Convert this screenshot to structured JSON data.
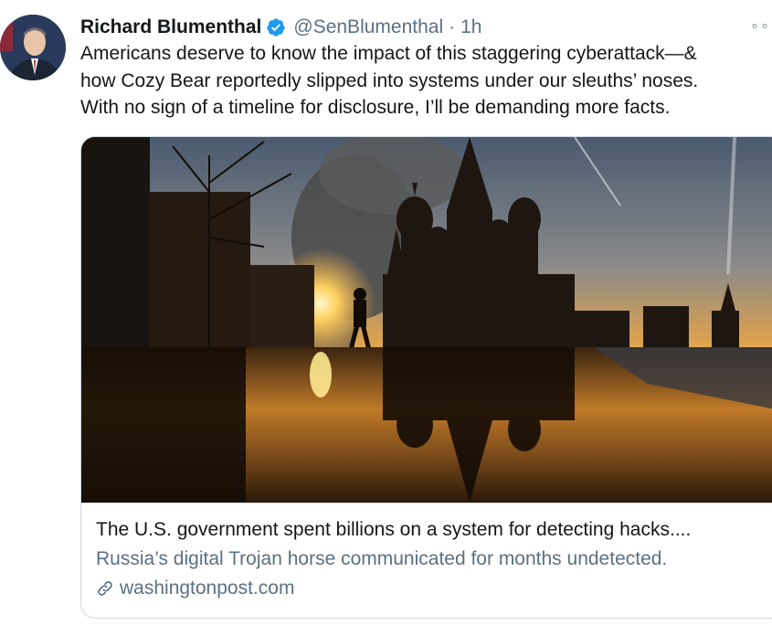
{
  "tweet": {
    "author_name": "Richard Blumenthal",
    "handle": "@SenBlumenthal",
    "separator": "·",
    "time": "1h",
    "more_glyph": "∘∘",
    "text_lines": [
      "Americans deserve to know the impact of this staggering cyberattack—&",
      "how Cozy Bear reportedly slipped into systems under our sleuths’ noses.",
      "With no sign of a timeline for disclosure, I’ll be demanding more facts."
    ]
  },
  "card": {
    "title": "The U.S. government spent billions on a system for detecting hacks....",
    "description": "Russia’s digital Trojan horse communicated for months undetected.",
    "domain": "washingtonpost.com",
    "link_icon": "link-icon"
  },
  "colors": {
    "verified": "#1d9bf0",
    "secondary_text": "#5b7083",
    "border": "#cfd9de"
  }
}
